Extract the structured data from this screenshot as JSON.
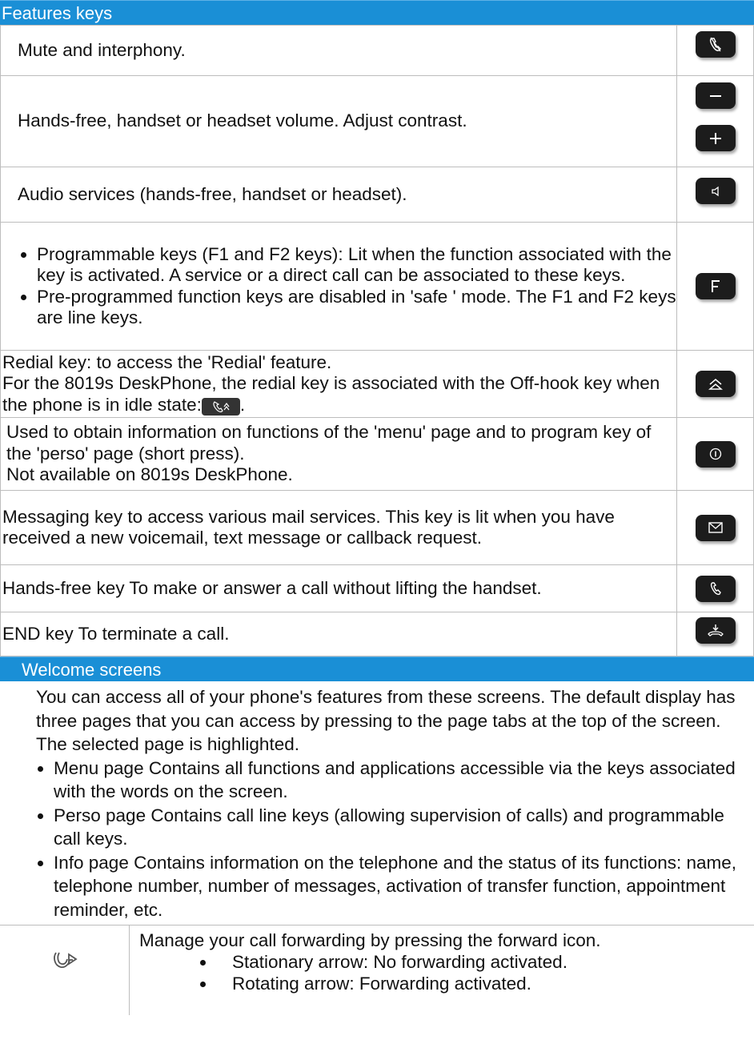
{
  "features": {
    "title": "Features keys",
    "rows": [
      {
        "text": "Mute and interphony.",
        "key_icon": "mute-icon"
      },
      {
        "text": "Hands-free, handset or headset volume. Adjust contrast.",
        "key_icons": [
          "minus-icon",
          "plus-icon"
        ]
      },
      {
        "text": "Audio services (hands-free, handset or headset).",
        "key_icon": "speaker-icon"
      },
      {
        "bullets": [
          "Programmable keys (F1 and F2 keys): Lit when the function associated with the key is activated. A service or a direct call can be associated to these keys.",
          "Pre-programmed function keys are disabled in 'safe ' mode. The F1 and F2 keys are line keys."
        ],
        "key_icon": "f-key-icon"
      },
      {
        "lines": [
          "Redial key: to access the 'Redial' feature.",
          "For the 8019s DeskPhone, the redial key is associated with the Off-hook key when the phone is in idle state:",
          "."
        ],
        "key_icon": "redial-icon"
      },
      {
        "lines": [
          "Used to obtain information on functions of the 'menu' page and to program key of the 'perso' page (short press).",
          "Not available on 8019s DeskPhone."
        ],
        "key_icon": "info-icon"
      },
      {
        "text": "Messaging key to access various mail services. This key is lit when you have received a new voicemail, text message or callback request.",
        "key_icon": "envelope-icon"
      },
      {
        "text": "Hands-free key To make or answer a call without lifting the handset.",
        "key_icon": "handset-icon"
      },
      {
        "text": "END key To terminate a call.",
        "key_icon": "hangup-icon"
      }
    ]
  },
  "welcome": {
    "title": "Welcome screens",
    "intro": "You can access all of your phone's features from these screens. The default display has three pages that you can access by pressing to the page tabs at the top of the screen. The selected page is highlighted.",
    "bullets": [
      "Menu page Contains all functions and applications accessible via the keys associated with the words on the screen.",
      "Perso page Contains call line keys (allowing supervision of calls) and programmable call keys.",
      "Info page Contains information on the telephone and the status of its functions: name, telephone number, number of messages, activation of transfer function, appointment reminder, etc."
    ],
    "forward": {
      "icon": "forward-arrow-icon",
      "text": "Manage your call forwarding by pressing the forward icon.",
      "bullets": [
        "Stationary arrow: No forwarding activated.",
        "Rotating arrow: Forwarding activated."
      ]
    }
  }
}
